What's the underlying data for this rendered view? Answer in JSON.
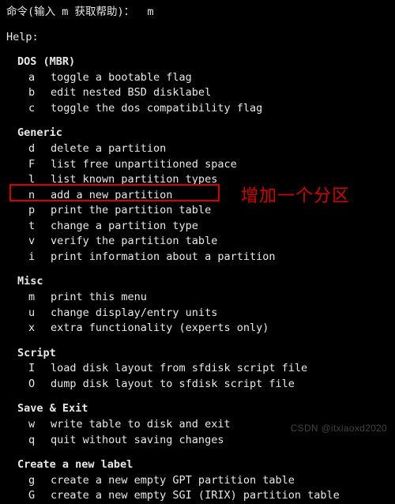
{
  "prompt": {
    "label": "命令(输入 m 获取帮助)：  m"
  },
  "help_label": "Help:",
  "sections": {
    "dos": {
      "title": "DOS (MBR)",
      "rows": [
        {
          "key": "a",
          "desc": "toggle a bootable flag"
        },
        {
          "key": "b",
          "desc": "edit nested BSD disklabel"
        },
        {
          "key": "c",
          "desc": "toggle the dos compatibility flag"
        }
      ]
    },
    "generic": {
      "title": "Generic",
      "rows": [
        {
          "key": "d",
          "desc": "delete a partition"
        },
        {
          "key": "F",
          "desc": "list free unpartitioned space"
        },
        {
          "key": "l",
          "desc": "list known partition types"
        },
        {
          "key": "n",
          "desc": "add a new partition"
        },
        {
          "key": "p",
          "desc": "print the partition table"
        },
        {
          "key": "t",
          "desc": "change a partition type"
        },
        {
          "key": "v",
          "desc": "verify the partition table"
        },
        {
          "key": "i",
          "desc": "print information about a partition"
        }
      ]
    },
    "misc": {
      "title": "Misc",
      "rows": [
        {
          "key": "m",
          "desc": "print this menu"
        },
        {
          "key": "u",
          "desc": "change display/entry units"
        },
        {
          "key": "x",
          "desc": "extra functionality (experts only)"
        }
      ]
    },
    "script": {
      "title": "Script",
      "rows": [
        {
          "key": "I",
          "desc": "load disk layout from sfdisk script file"
        },
        {
          "key": "O",
          "desc": "dump disk layout to sfdisk script file"
        }
      ]
    },
    "save": {
      "title": "Save & Exit",
      "rows": [
        {
          "key": "w",
          "desc": "write table to disk and exit"
        },
        {
          "key": "q",
          "desc": "quit without saving changes"
        }
      ]
    },
    "label": {
      "title": "Create a new label",
      "rows": [
        {
          "key": "g",
          "desc": "create a new empty GPT partition table"
        },
        {
          "key": "G",
          "desc": "create a new empty SGI (IRIX) partition table"
        }
      ]
    }
  },
  "annotation": "增加一个分区",
  "watermark": "CSDN @itxiaoxd2020"
}
